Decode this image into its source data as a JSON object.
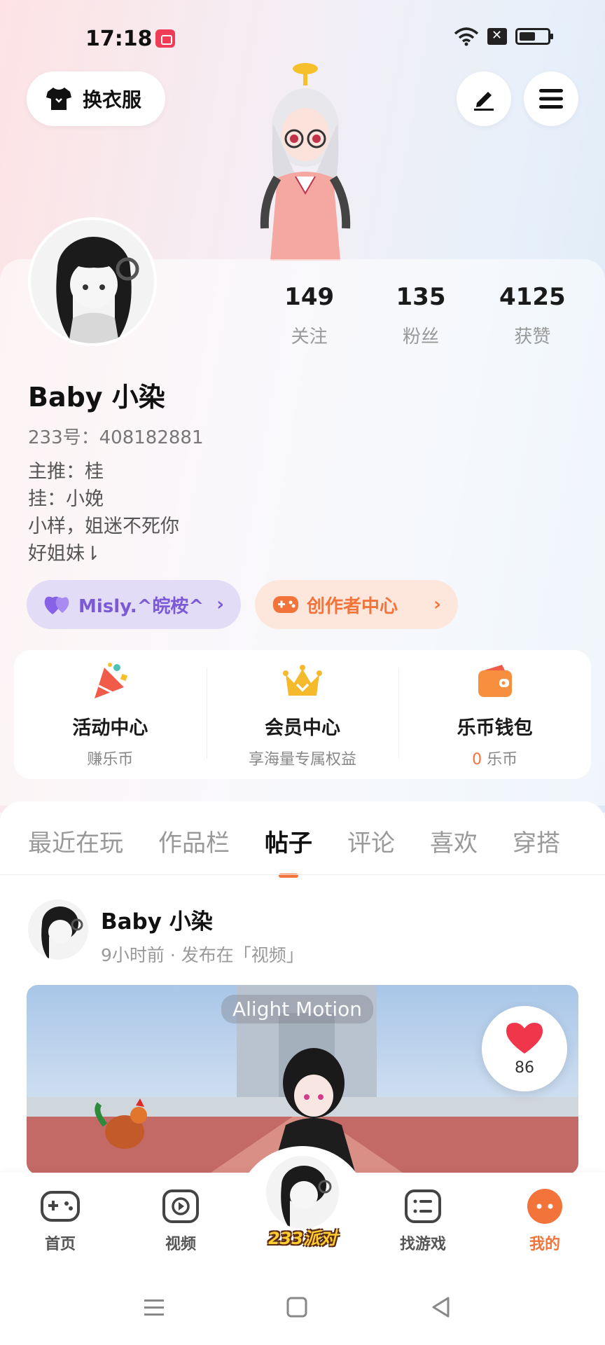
{
  "status_bar": {
    "time": "17:18",
    "watermark": "图标 回看"
  },
  "header": {
    "outfit_label": "换衣服"
  },
  "profile": {
    "name": "Baby 小染",
    "id_text": "233号：408182881",
    "bio": [
      "主推：桂",
      "挂：小娩",
      "小样，姐迷不死你",
      "好姐妹⇂"
    ],
    "stats": [
      {
        "value": "149",
        "label": "关注"
      },
      {
        "value": "135",
        "label": "粉丝"
      },
      {
        "value": "4125",
        "label": "获赞"
      }
    ],
    "guild_chip": "Misly.^皖桉^",
    "creator_chip": "创作者中心"
  },
  "services": [
    {
      "title": "活动中心",
      "sub": "赚乐币"
    },
    {
      "title": "会员中心",
      "sub": "享海量专属权益"
    },
    {
      "title": "乐币钱包",
      "sub_num": "0",
      "sub_unit": " 乐币"
    }
  ],
  "tabs": [
    "最近在玩",
    "作品栏",
    "帖子",
    "评论",
    "喜欢",
    "穿搭"
  ],
  "active_tab": "帖子",
  "post": {
    "author": "Baby 小染",
    "meta": "9小时前 · 发布在「视频」",
    "media_watermark": "Alight Motion",
    "likes": "86"
  },
  "bottom_nav": [
    {
      "label": "首页",
      "icon": "gamepad-icon"
    },
    {
      "label": "视频",
      "icon": "play-icon"
    },
    {
      "label": "233派对",
      "icon": "party-avatar"
    },
    {
      "label": "找游戏",
      "icon": "list-icon"
    },
    {
      "label": "我的",
      "icon": "me-icon"
    }
  ],
  "colors": {
    "accent": "#f3743b",
    "guild": "#7c5ad6",
    "like": "#f0364a"
  }
}
